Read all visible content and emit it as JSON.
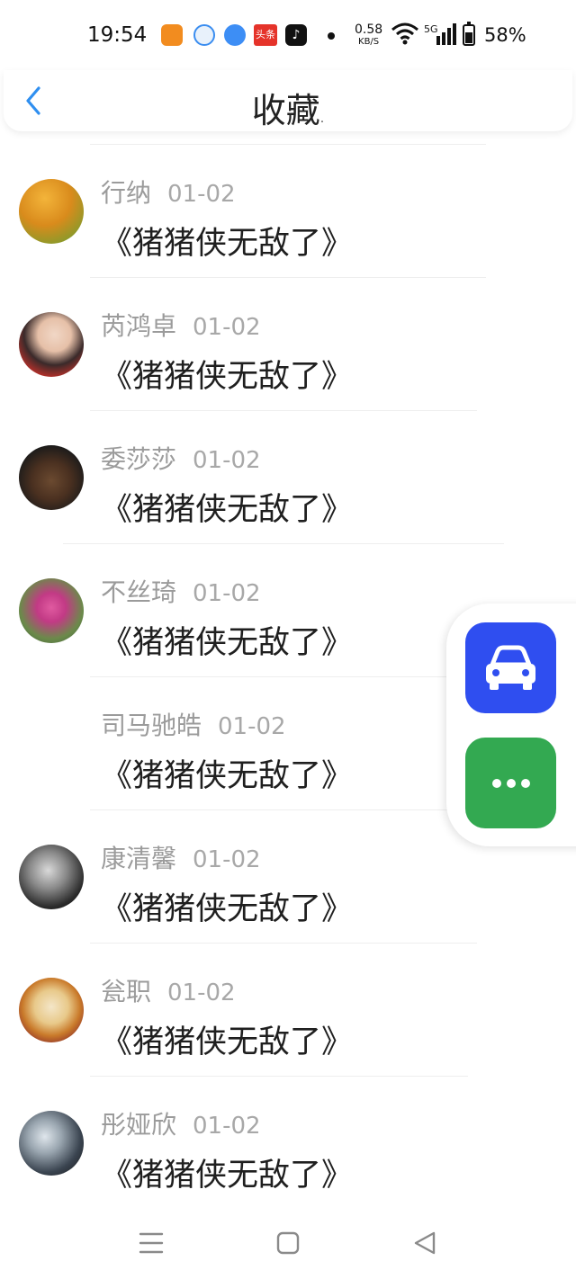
{
  "status_bar": {
    "time": "19:54",
    "app_icons": [
      "orange-app-icon",
      "circle-app-icon",
      "browser-icon",
      "toutiao-icon",
      "tiktok-icon"
    ],
    "toutiao_text": "头条",
    "net_speed": "0.58",
    "net_speed_unit": "KB/S",
    "signal_label": "5G",
    "battery_percent": "58%",
    "battery_level": 0.58
  },
  "header": {
    "title": "收藏",
    "title_mark": ".",
    "back_icon": "chevron-left-icon",
    "accent_color": "#2f8ff0"
  },
  "items": [
    {
      "name": "行纳",
      "date": "01-02",
      "content": "《猪猪侠无敌了》",
      "has_avatar": true
    },
    {
      "name": "芮鸿卓",
      "date": "01-02",
      "content": "《猪猪侠无敌了》",
      "has_avatar": true
    },
    {
      "name": "委莎莎",
      "date": "01-02",
      "content": "《猪猪侠无敌了》",
      "has_avatar": true
    },
    {
      "name": "不丝琦",
      "date": "01-02",
      "content": "《猪猪侠无敌了》",
      "has_avatar": true
    },
    {
      "name": "司马驰皓",
      "date": "01-02",
      "content": "《猪猪侠无敌了》",
      "has_avatar": false
    },
    {
      "name": "康清馨",
      "date": "01-02",
      "content": "《猪猪侠无敌了》",
      "has_avatar": true
    },
    {
      "name": "瓮职",
      "date": "01-02",
      "content": "《猪猪侠无敌了》",
      "has_avatar": true
    },
    {
      "name": "彤娅欣",
      "date": "01-02",
      "content": "《猪猪侠无敌了》",
      "has_avatar": true
    }
  ],
  "floating_buttons": {
    "car": {
      "icon": "car-icon",
      "color": "#2f4ef0"
    },
    "more": {
      "icon": "more-dots-icon",
      "color": "#33a951"
    }
  },
  "nav_bar": {
    "menu": "menu-icon",
    "home": "home-square-icon",
    "back": "back-triangle-icon"
  }
}
